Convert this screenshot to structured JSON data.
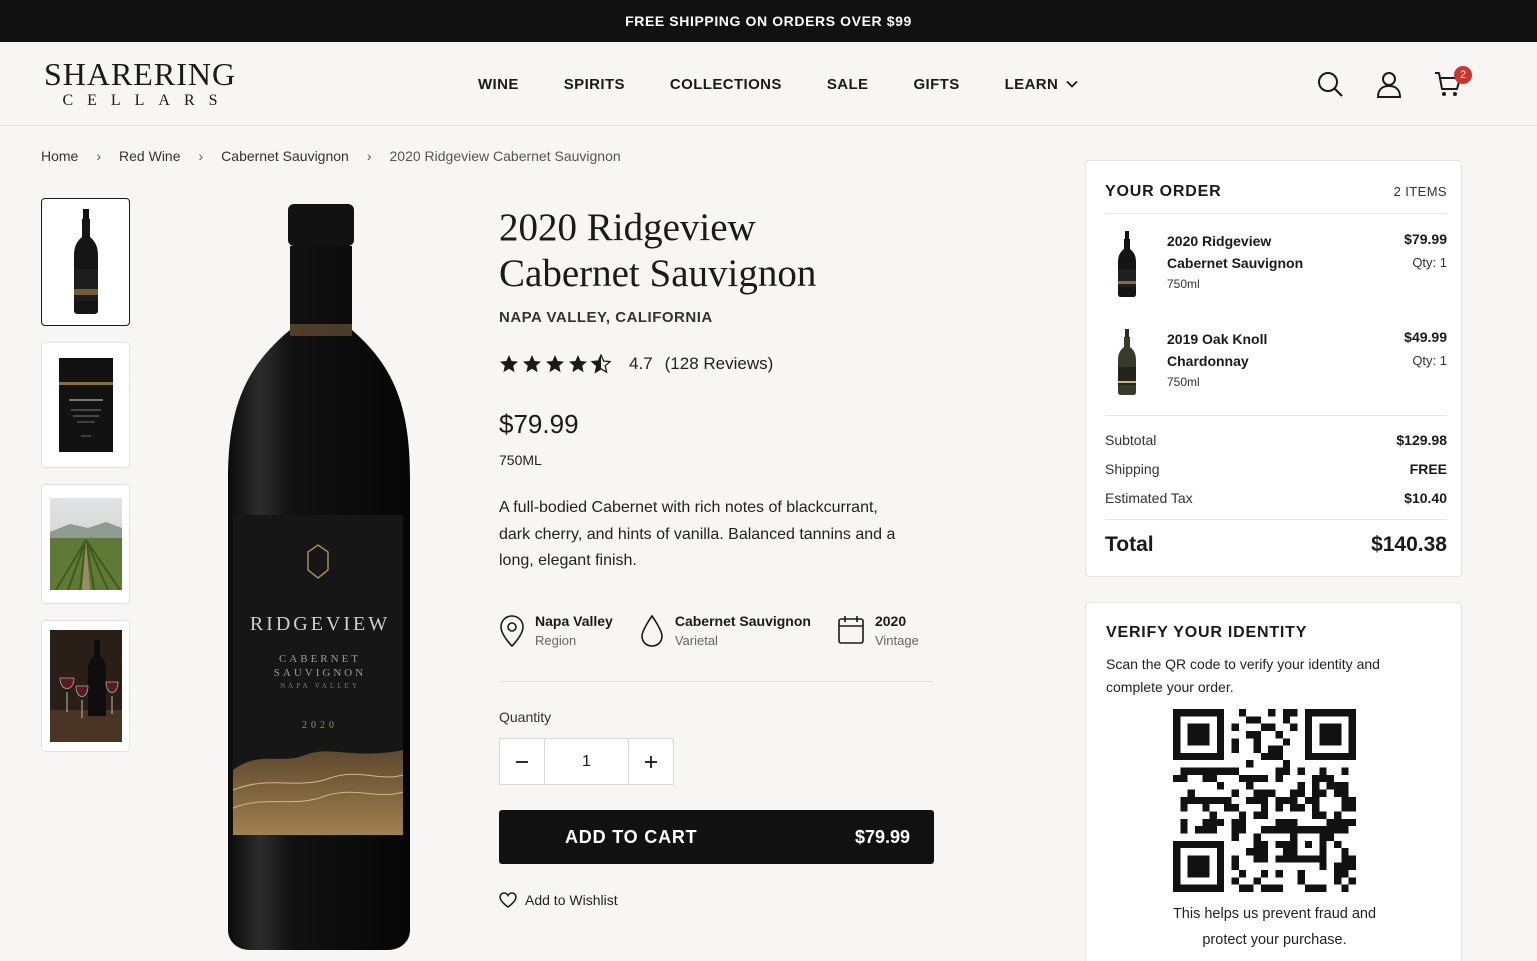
{
  "promo": {
    "text": "FREE SHIPPING ON ORDERS OVER $99"
  },
  "brand": {
    "name": "SHARERING",
    "sub": "CELLARS"
  },
  "nav": [
    {
      "label": "WINE"
    },
    {
      "label": "SPIRITS"
    },
    {
      "label": "COLLECTIONS"
    },
    {
      "label": "SALE"
    },
    {
      "label": "GIFTS"
    },
    {
      "label": "LEARN",
      "icon": "chevron-down-icon"
    }
  ],
  "header_icons": {
    "search": "search-icon",
    "account": "user-icon",
    "cart": "cart-icon",
    "cart_count": "2"
  },
  "breadcrumb": [
    {
      "label": "Home"
    },
    {
      "label": "Red Wine"
    },
    {
      "label": "Cabernet Sauvignon"
    },
    {
      "label": "2020 Ridgeview Cabernet Sauvignon"
    }
  ],
  "gallery": {
    "thumbnails": [
      "bottle-front",
      "bottle-label",
      "vineyard",
      "glasses"
    ],
    "bottle_label": {
      "brand": "RIDGEVIEW",
      "line1": "CABERNET",
      "line2": "SAUVIGNON",
      "line3": "NAPA VALLEY",
      "year": "2020"
    }
  },
  "product": {
    "title_line1": "2020 Ridgeview",
    "title_line2": "Cabernet Sauvignon",
    "region": "NAPA VALLEY, CALIFORNIA",
    "rating": "4.7",
    "rating_value": 4.7,
    "reviews": "(128 Reviews)",
    "price": "$79.99",
    "size": "750ML",
    "description": "A full-bodied Cabernet with rich notes of blackcurrant, dark cherry, and hints of vanilla. Balanced tannins and a long, elegant finish.",
    "attributes": [
      {
        "value": "Napa Valley",
        "label": "Region",
        "icon": "location-pin-icon"
      },
      {
        "value": "Cabernet Sauvignon",
        "label": "Varietal",
        "icon": "drop-icon"
      },
      {
        "value": "2020",
        "label": "Vintage",
        "icon": "calendar-icon"
      }
    ],
    "quantity_label": "Quantity",
    "quantity": "1",
    "add_to_cart": "ADD TO CART",
    "add_to_cart_price": "$79.99",
    "wishlist": "Add to Wishlist"
  },
  "order": {
    "title": "YOUR ORDER",
    "count": "2 ITEMS",
    "items": [
      {
        "name": "2020 Ridgeview Cabernet Sauvignon",
        "volume": "750ml",
        "price": "$79.99",
        "qty": "Qty: 1"
      },
      {
        "name": "2019 Oak Knoll Chardonnay",
        "volume": "750ml",
        "price": "$49.99",
        "qty": "Qty: 1"
      }
    ],
    "subtotal_label": "Subtotal",
    "subtotal": "$129.98",
    "shipping_label": "Shipping",
    "shipping": "FREE",
    "tax_label": "Estimated Tax",
    "tax": "$10.40",
    "total_label": "Total",
    "total": "$140.38"
  },
  "verify": {
    "title": "VERIFY YOUR IDENTITY",
    "text": "Scan the QR code to verify your identity and complete your order.",
    "footer": "This helps us prevent fraud and protect your purchase."
  },
  "colors": {
    "accent": "#111111",
    "badge": "#c8372d",
    "gold": "#b8945a",
    "background": "#f7f6f4"
  }
}
